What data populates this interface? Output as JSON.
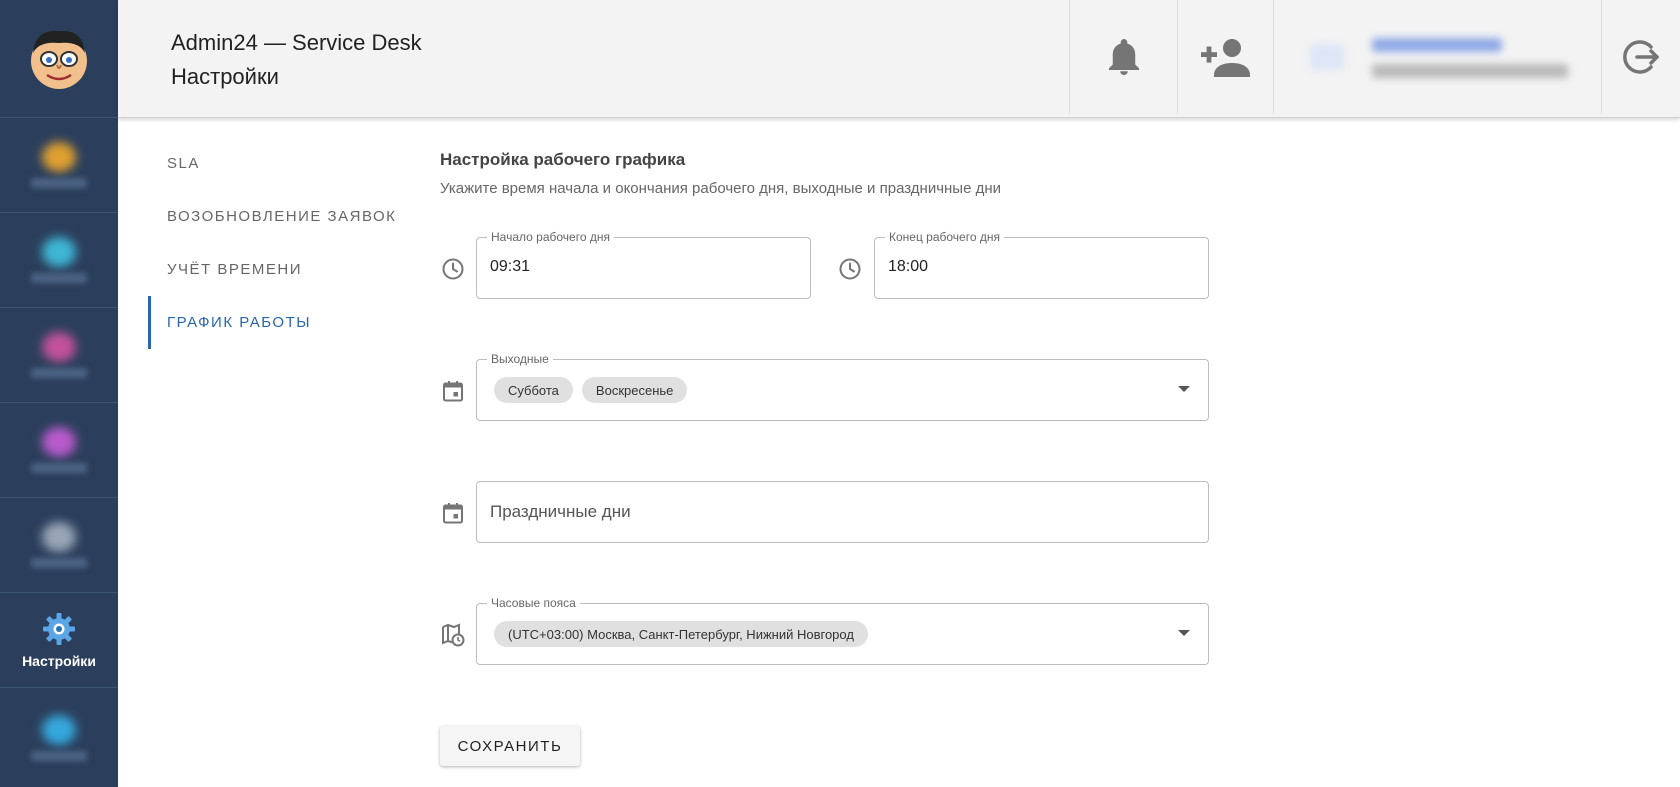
{
  "sidebar": {
    "active_label": "Настройки",
    "blurred_items": [
      {
        "color": "#e0a030"
      },
      {
        "color": "#3fb6d6"
      },
      {
        "color": "#c2529a"
      },
      {
        "color": "#b85acb"
      },
      {
        "color": "#9aa6b8"
      },
      {
        "color": "#36a8de"
      }
    ]
  },
  "header": {
    "app_title": "Admin24 — Service Desk",
    "page_title": "Настройки"
  },
  "subnav": {
    "items": [
      {
        "label": "SLA"
      },
      {
        "label": "Возобновление заявок"
      },
      {
        "label": "Учёт времени"
      },
      {
        "label": "График работы"
      }
    ],
    "active_index": 3
  },
  "schedule": {
    "title": "Настройка рабочего графика",
    "subtitle": "Укажите время начала и окончания рабочего дня, выходные и праздничные дни",
    "start_label": "Начало рабочего дня",
    "start_value": "09:31",
    "end_label": "Конец рабочего дня",
    "end_value": "18:00",
    "weekends_label": "Выходные",
    "weekends": [
      "Суббота",
      "Воскресенье"
    ],
    "holidays_placeholder": "Праздничные дни",
    "timezones_label": "Часовые пояса",
    "timezone_value": "(UTC+03:00) Москва, Санкт-Петербург, Нижний Новгород",
    "save_label": "Сохранить"
  },
  "colors": {
    "sidebar_bg": "#2b3f5c",
    "accent": "#2a66a8"
  }
}
